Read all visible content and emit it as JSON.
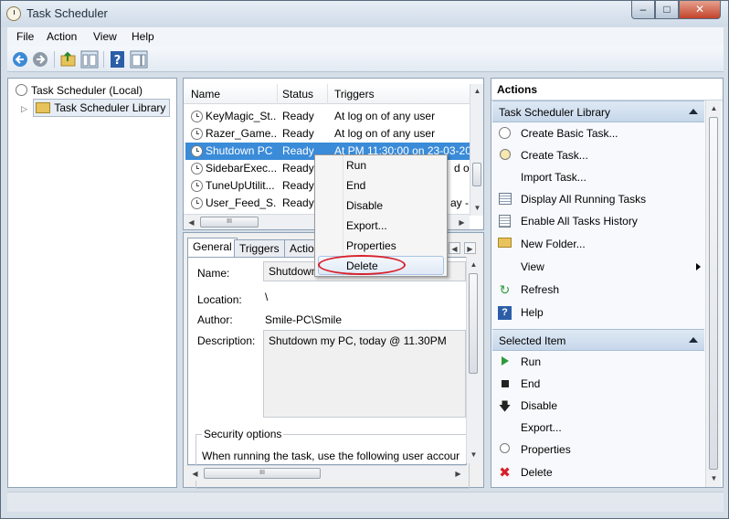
{
  "window": {
    "title": "Task Scheduler"
  },
  "menu": [
    "File",
    "Action",
    "View",
    "Help"
  ],
  "tree": {
    "root": "Task Scheduler (Local)",
    "library": "Task Scheduler Library"
  },
  "task_list": {
    "columns": [
      "Name",
      "Status",
      "Triggers"
    ],
    "rows": [
      {
        "name": "KeyMagic_St...",
        "status": "Ready",
        "trigger": "At log on of any user"
      },
      {
        "name": "Razer_Game...",
        "status": "Ready",
        "trigger": "At log on of any user"
      },
      {
        "name": "Shutdown PC",
        "status": "Ready",
        "trigger": "At PM 11:30:00 on 23-03-20"
      },
      {
        "name": "SidebarExec...",
        "status": "Ready",
        "trigger": "d or"
      },
      {
        "name": "TuneUpUtilit...",
        "status": "Ready",
        "trigger": ""
      },
      {
        "name": "User_Feed_S...",
        "status": "Ready",
        "trigger": "ay - "
      }
    ],
    "hscroll_grip": "III"
  },
  "details": {
    "tabs": [
      "General",
      "Triggers",
      "Actio"
    ],
    "name_label": "Name:",
    "name_value": "Shutdown",
    "location_label": "Location:",
    "location_value": "\\",
    "author_label": "Author:",
    "author_value": "Smile-PC\\Smile",
    "description_label": "Description:",
    "description_value": "Shutdown my PC, today @ 11.30PM",
    "security_title": "Security options",
    "security_text": "When running the task, use the following user accour",
    "hscroll_grip": "III"
  },
  "context_menu": [
    "Run",
    "End",
    "Disable",
    "Export...",
    "Properties",
    "Delete"
  ],
  "actions": {
    "title": "Actions",
    "section1": "Task Scheduler Library",
    "items1": [
      {
        "label": "Create Basic Task...",
        "icon": "clock-wizard-icon"
      },
      {
        "label": "Create Task...",
        "icon": "clock-new-icon"
      },
      {
        "label": "Import Task...",
        "icon": ""
      },
      {
        "label": "Display All Running Tasks",
        "icon": "list-icon"
      },
      {
        "label": "Enable All Tasks History",
        "icon": "history-icon"
      },
      {
        "label": "New Folder...",
        "icon": "folder-icon"
      },
      {
        "label": "View",
        "icon": ""
      },
      {
        "label": "Refresh",
        "icon": "refresh-icon"
      },
      {
        "label": "Help",
        "icon": "help-icon"
      }
    ],
    "section2": "Selected Item",
    "items2": [
      {
        "label": "Run",
        "icon": "play-icon"
      },
      {
        "label": "End",
        "icon": "stop-icon"
      },
      {
        "label": "Disable",
        "icon": "down-arrow-icon"
      },
      {
        "label": "Export...",
        "icon": ""
      },
      {
        "label": "Properties",
        "icon": "properties-icon"
      },
      {
        "label": "Delete",
        "icon": "delete-icon"
      }
    ]
  },
  "colors": {
    "selection": "#3a8bd8",
    "highlight_ring": "#d8202a",
    "section_header": "#c6d7ea"
  }
}
